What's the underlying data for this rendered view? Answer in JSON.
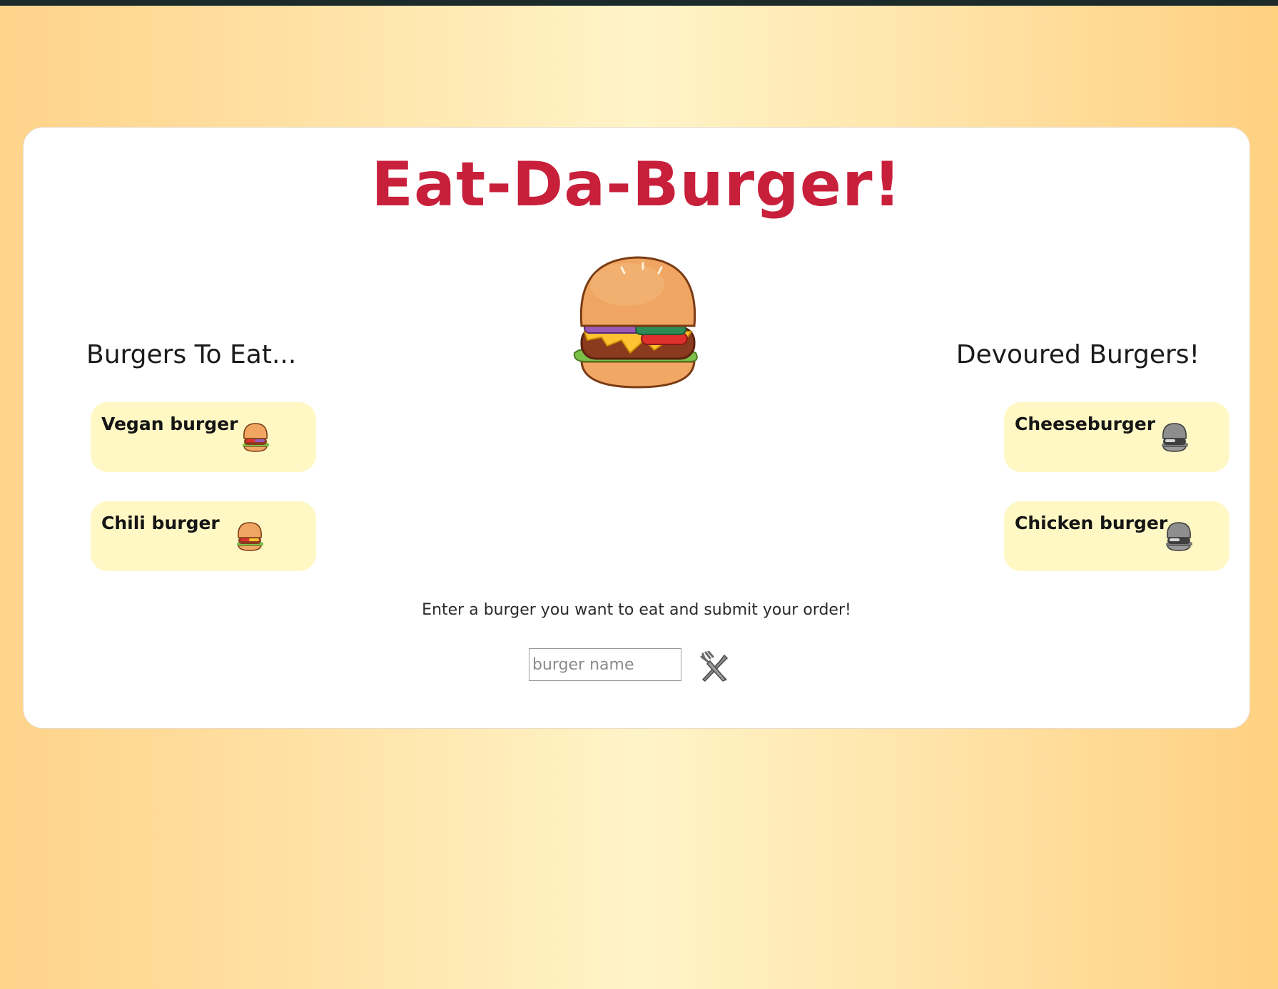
{
  "app": {
    "title": "Eat-Da-Burger!"
  },
  "columns": {
    "to_eat_heading": "Burgers To Eat...",
    "devoured_heading": "Devoured Burgers!"
  },
  "burgers_to_eat": [
    {
      "name": "Vegan burger",
      "icon": "burger-icon"
    },
    {
      "name": "Chili burger",
      "icon": "burger-icon"
    }
  ],
  "devoured_burgers": [
    {
      "name": "Cheeseburger",
      "icon": "burger-gray-icon"
    },
    {
      "name": "Chicken burger",
      "icon": "burger-gray-icon"
    }
  ],
  "order_form": {
    "prompt": "Enter a burger you want to eat and submit your order!",
    "placeholder": "burger name",
    "value": "",
    "submit_icon": "fork-knife-icon"
  },
  "colors": {
    "title": "#c8203a",
    "card_bg": "#fff8c4",
    "background_center": "#fff4c8",
    "background_edge": "#ffd38a"
  }
}
